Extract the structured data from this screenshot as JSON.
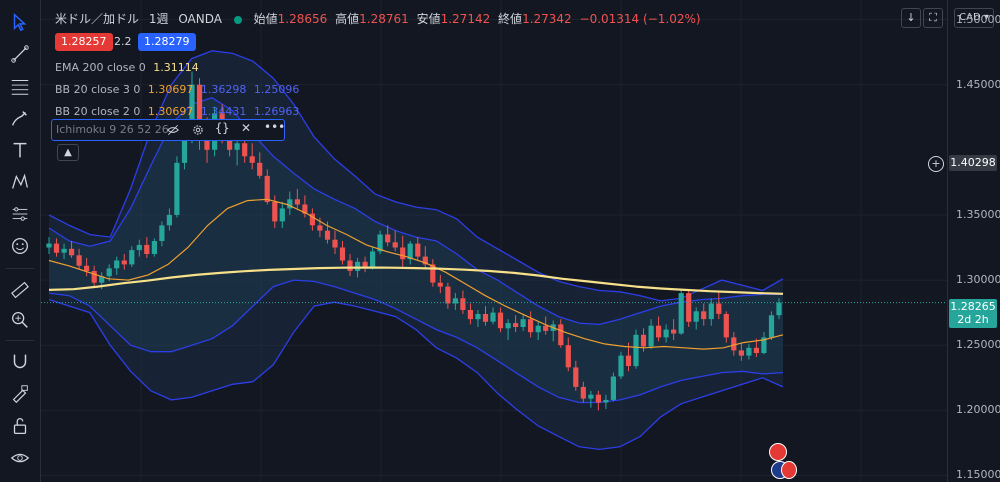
{
  "header": {
    "symbol": "米ドル／加ドル",
    "interval": "1週",
    "source": "OANDA",
    "open_label": "始値",
    "open": "1.28656",
    "high_label": "高値",
    "high": "1.28761",
    "low_label": "安値",
    "low": "1.27142",
    "close_label": "終値",
    "close": "1.27342",
    "change": "−0.01314 (−1.02%)",
    "sell_price": "1.28257",
    "spread": "2.2",
    "buy_price": "1.28279",
    "currency": "CAD"
  },
  "indicators": {
    "ema": {
      "name": "EMA 200 close 0",
      "value": "1.31114"
    },
    "bb3": {
      "name": "BB 20 close 3 0",
      "mid": "1.30697",
      "upper": "1.36298",
      "lower": "1.25096"
    },
    "bb2": {
      "name": "BB 20 close 2 0",
      "mid": "1.30697",
      "upper": "1.34431",
      "lower": "1.26963"
    },
    "ichimoku": {
      "name": "Ichimoku 9 26 52 26"
    }
  },
  "price_axis": {
    "ticks": [
      "1.50000",
      "1.45000",
      "1.40298",
      "1.35000",
      "1.30000",
      "1.25000",
      "1.20000",
      "1.15000"
    ],
    "crosshair_price": "1.40298",
    "last_price": "1.28265",
    "countdown": "2d 2h"
  },
  "colors": {
    "up": "#26a69a",
    "down": "#ef5350",
    "ema": "#f7e08a",
    "bb_mid": "#f0a030",
    "bb_band": "#2c3ee8",
    "background": "#131722"
  },
  "toolbar_icons": [
    "cursor-icon",
    "trendline-icon",
    "fib-icon",
    "brush-icon",
    "text-icon",
    "pattern-icon",
    "prediction-icon",
    "emoji-icon",
    "ruler-icon",
    "zoom-icon",
    "magnet-icon",
    "lock-draw-icon",
    "lock-icon",
    "eye-icon"
  ],
  "chart_data": {
    "type": "candlestick",
    "ylim": [
      1.145,
      1.515
    ],
    "y_ticks": [
      1.5,
      1.45,
      1.35,
      1.3,
      1.25,
      1.2,
      1.15
    ],
    "candles": [
      [
        1.325,
        1.333,
        1.32,
        1.328
      ],
      [
        1.328,
        1.332,
        1.318,
        1.321
      ],
      [
        1.321,
        1.328,
        1.316,
        1.324
      ],
      [
        1.324,
        1.33,
        1.317,
        1.319
      ],
      [
        1.319,
        1.324,
        1.308,
        1.311
      ],
      [
        1.311,
        1.317,
        1.303,
        1.307
      ],
      [
        1.307,
        1.311,
        1.295,
        1.298
      ],
      [
        1.298,
        1.306,
        1.293,
        1.303
      ],
      [
        1.303,
        1.312,
        1.299,
        1.309
      ],
      [
        1.309,
        1.318,
        1.304,
        1.315
      ],
      [
        1.315,
        1.32,
        1.308,
        1.312
      ],
      [
        1.312,
        1.326,
        1.31,
        1.323
      ],
      [
        1.323,
        1.331,
        1.318,
        1.327
      ],
      [
        1.327,
        1.333,
        1.317,
        1.32
      ],
      [
        1.32,
        1.332,
        1.318,
        1.33
      ],
      [
        1.33,
        1.345,
        1.326,
        1.342
      ],
      [
        1.342,
        1.355,
        1.338,
        1.35
      ],
      [
        1.35,
        1.395,
        1.348,
        1.39
      ],
      [
        1.39,
        1.42,
        1.385,
        1.415
      ],
      [
        1.415,
        1.46,
        1.405,
        1.45
      ],
      [
        1.45,
        1.455,
        1.4,
        1.415
      ],
      [
        1.415,
        1.425,
        1.39,
        1.4
      ],
      [
        1.4,
        1.433,
        1.395,
        1.428
      ],
      [
        1.428,
        1.435,
        1.405,
        1.41
      ],
      [
        1.41,
        1.42,
        1.395,
        1.4
      ],
      [
        1.4,
        1.41,
        1.388,
        1.405
      ],
      [
        1.405,
        1.408,
        1.39,
        1.395
      ],
      [
        1.395,
        1.405,
        1.385,
        1.39
      ],
      [
        1.39,
        1.398,
        1.378,
        1.38
      ],
      [
        1.38,
        1.385,
        1.358,
        1.36
      ],
      [
        1.36,
        1.365,
        1.34,
        1.345
      ],
      [
        1.345,
        1.36,
        1.34,
        1.355
      ],
      [
        1.355,
        1.368,
        1.35,
        1.362
      ],
      [
        1.362,
        1.37,
        1.355,
        1.358
      ],
      [
        1.358,
        1.365,
        1.348,
        1.351
      ],
      [
        1.351,
        1.355,
        1.338,
        1.342
      ],
      [
        1.342,
        1.348,
        1.333,
        1.338
      ],
      [
        1.338,
        1.345,
        1.328,
        1.331
      ],
      [
        1.331,
        1.338,
        1.32,
        1.325
      ],
      [
        1.325,
        1.33,
        1.312,
        1.315
      ],
      [
        1.315,
        1.32,
        1.303,
        1.307
      ],
      [
        1.307,
        1.317,
        1.302,
        1.314
      ],
      [
        1.314,
        1.318,
        1.306,
        1.309
      ],
      [
        1.309,
        1.325,
        1.308,
        1.322
      ],
      [
        1.322,
        1.338,
        1.32,
        1.335
      ],
      [
        1.335,
        1.342,
        1.326,
        1.329
      ],
      [
        1.329,
        1.338,
        1.322,
        1.325
      ],
      [
        1.325,
        1.334,
        1.31,
        1.316
      ],
      [
        1.316,
        1.33,
        1.312,
        1.328
      ],
      [
        1.328,
        1.333,
        1.315,
        1.318
      ],
      [
        1.318,
        1.326,
        1.308,
        1.312
      ],
      [
        1.312,
        1.316,
        1.295,
        1.298
      ],
      [
        1.298,
        1.304,
        1.29,
        1.295
      ],
      [
        1.295,
        1.298,
        1.278,
        1.282
      ],
      [
        1.282,
        1.29,
        1.277,
        1.286
      ],
      [
        1.286,
        1.292,
        1.274,
        1.277
      ],
      [
        1.277,
        1.282,
        1.266,
        1.27
      ],
      [
        1.27,
        1.277,
        1.264,
        1.274
      ],
      [
        1.274,
        1.28,
        1.265,
        1.268
      ],
      [
        1.268,
        1.279,
        1.266,
        1.275
      ],
      [
        1.275,
        1.279,
        1.26,
        1.263
      ],
      [
        1.263,
        1.27,
        1.254,
        1.267
      ],
      [
        1.267,
        1.273,
        1.26,
        1.264
      ],
      [
        1.264,
        1.274,
        1.261,
        1.27
      ],
      [
        1.27,
        1.276,
        1.256,
        1.26
      ],
      [
        1.26,
        1.268,
        1.254,
        1.265
      ],
      [
        1.265,
        1.272,
        1.258,
        1.261
      ],
      [
        1.261,
        1.269,
        1.253,
        1.266
      ],
      [
        1.266,
        1.27,
        1.248,
        1.25
      ],
      [
        1.25,
        1.256,
        1.23,
        1.233
      ],
      [
        1.233,
        1.238,
        1.215,
        1.218
      ],
      [
        1.218,
        1.222,
        1.206,
        1.209
      ],
      [
        1.209,
        1.215,
        1.202,
        1.212
      ],
      [
        1.212,
        1.215,
        1.2,
        1.206
      ],
      [
        1.206,
        1.212,
        1.201,
        1.208
      ],
      [
        1.208,
        1.229,
        1.207,
        1.226
      ],
      [
        1.226,
        1.245,
        1.224,
        1.242
      ],
      [
        1.242,
        1.252,
        1.23,
        1.234
      ],
      [
        1.234,
        1.262,
        1.232,
        1.258
      ],
      [
        1.258,
        1.263,
        1.245,
        1.249
      ],
      [
        1.249,
        1.27,
        1.247,
        1.265
      ],
      [
        1.265,
        1.272,
        1.253,
        1.256
      ],
      [
        1.256,
        1.266,
        1.252,
        1.262
      ],
      [
        1.262,
        1.27,
        1.254,
        1.259
      ],
      [
        1.259,
        1.293,
        1.258,
        1.29
      ],
      [
        1.29,
        1.293,
        1.264,
        1.268
      ],
      [
        1.268,
        1.279,
        1.262,
        1.276
      ],
      [
        1.276,
        1.282,
        1.265,
        1.27
      ],
      [
        1.27,
        1.286,
        1.265,
        1.282
      ],
      [
        1.282,
        1.292,
        1.27,
        1.274
      ],
      [
        1.274,
        1.276,
        1.252,
        1.256
      ],
      [
        1.256,
        1.26,
        1.242,
        1.246
      ],
      [
        1.246,
        1.252,
        1.238,
        1.242
      ],
      [
        1.242,
        1.251,
        1.239,
        1.248
      ],
      [
        1.248,
        1.255,
        1.241,
        1.244
      ],
      [
        1.244,
        1.26,
        1.243,
        1.256
      ],
      [
        1.256,
        1.276,
        1.254,
        1.273
      ],
      [
        1.273,
        1.286,
        1.27,
        1.2827
      ]
    ],
    "ema200": [
      1.2925,
      1.293,
      1.295,
      1.2975,
      1.2995,
      1.302,
      1.304,
      1.3055,
      1.3068,
      1.3078,
      1.3085,
      1.3092,
      1.3095,
      1.3096,
      1.3095,
      1.3092,
      1.3087,
      1.308,
      1.307,
      1.3055,
      1.3035,
      1.301,
      1.299,
      1.297,
      1.295,
      1.2935,
      1.2925,
      1.2915,
      1.2908,
      1.29,
      1.2895
    ],
    "bb_mid": [
      1.315,
      1.311,
      1.306,
      1.301,
      1.3,
      1.304,
      1.312,
      1.325,
      1.342,
      1.355,
      1.361,
      1.362,
      1.358,
      1.351,
      1.342,
      1.335,
      1.327,
      1.322,
      1.318,
      1.313,
      1.306,
      1.297,
      1.288,
      1.28,
      1.273,
      1.266,
      1.26,
      1.255,
      1.251,
      1.249,
      1.248,
      1.249,
      1.248,
      1.247,
      1.248,
      1.252,
      1.254,
      1.258
    ],
    "bb_upper3": [
      1.35,
      1.342,
      1.335,
      1.333,
      1.37,
      1.415,
      1.45,
      1.47,
      1.476,
      1.474,
      1.468,
      1.455,
      1.435,
      1.41,
      1.393,
      1.38,
      1.366,
      1.36,
      1.356,
      1.354,
      1.347,
      1.333,
      1.324,
      1.315,
      1.306,
      1.299,
      1.295,
      1.292,
      1.291,
      1.288,
      1.284,
      1.286,
      1.293,
      1.3,
      1.296,
      1.292,
      1.301
    ],
    "bb_lower3": [
      1.285,
      1.28,
      1.275,
      1.25,
      1.23,
      1.215,
      1.208,
      1.21,
      1.215,
      1.22,
      1.222,
      1.235,
      1.26,
      1.28,
      1.283,
      1.28,
      1.276,
      1.272,
      1.262,
      1.248,
      1.24,
      1.229,
      1.213,
      1.2,
      1.188,
      1.18,
      1.172,
      1.17,
      1.172,
      1.18,
      1.195,
      1.205,
      1.21,
      1.215,
      1.22,
      1.225,
      1.218
    ],
    "bb_upper2": [
      1.34,
      1.33,
      1.326,
      1.33,
      1.355,
      1.388,
      1.42,
      1.435,
      1.44,
      1.43,
      1.412,
      1.395,
      1.382,
      1.37,
      1.362,
      1.355,
      1.345,
      1.338,
      1.333,
      1.33,
      1.32,
      1.308,
      1.3,
      1.29,
      1.28,
      1.272,
      1.267,
      1.266,
      1.27,
      1.275,
      1.28,
      1.283,
      1.285,
      1.286,
      1.288,
      1.289,
      1.289
    ],
    "bb_lower2": [
      1.29,
      1.288,
      1.28,
      1.265,
      1.25,
      1.245,
      1.245,
      1.25,
      1.255,
      1.265,
      1.28,
      1.295,
      1.3,
      1.299,
      1.295,
      1.29,
      1.285,
      1.278,
      1.27,
      1.262,
      1.256,
      1.248,
      1.238,
      1.228,
      1.218,
      1.21,
      1.206,
      1.206,
      1.208,
      1.212,
      1.218,
      1.223,
      1.226,
      1.229,
      1.23,
      1.228,
      1.229
    ]
  }
}
